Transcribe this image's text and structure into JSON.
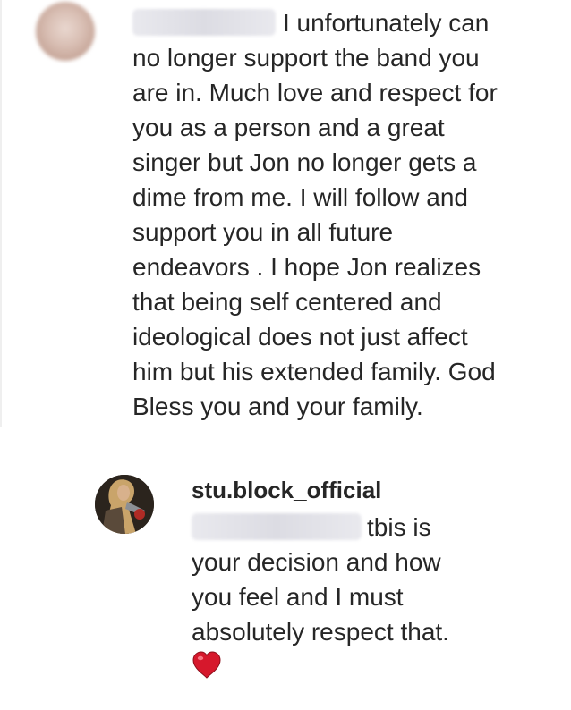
{
  "comments": [
    {
      "username_visible": false,
      "avatar_icon": "profile-avatar-blurred",
      "lines": [
        "I unfortunately can",
        "no longer support the band you",
        "are in. Much love and respect for",
        "you as a person and a great",
        "singer but Jon no longer gets a",
        "dime from me. I will follow and",
        "support you in all future",
        "endeavors . I hope Jon realizes",
        "that being self centered and",
        "ideological does not just affect",
        "him but his extended family. God",
        "Bless you and your family."
      ]
    }
  ],
  "reply": {
    "username": "stu.block_official",
    "avatar_icon": "profile-avatar",
    "lines": [
      "tbis is",
      "your decision and how",
      "you feel and I must",
      "absolutely respect that."
    ],
    "emoji": "red-heart-icon",
    "colors": {
      "heart": "#d6182c"
    }
  }
}
